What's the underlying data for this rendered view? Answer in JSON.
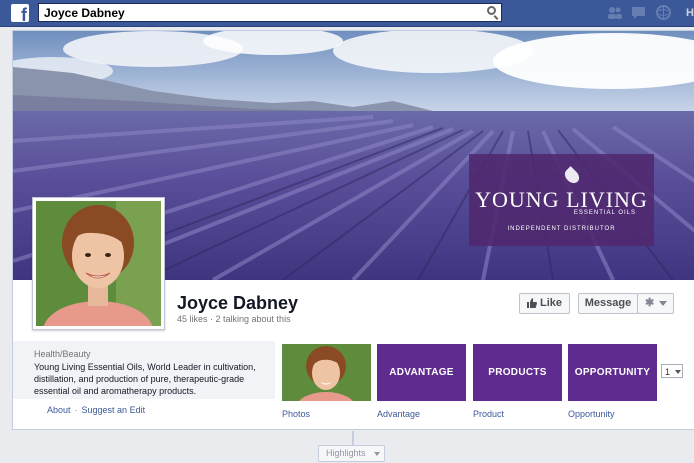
{
  "topbar": {
    "logo_glyph": "f",
    "search_value": "Joyce Dabney",
    "home_label": "H",
    "icons": [
      "friend-requests-icon",
      "messages-icon",
      "notifications-icon"
    ]
  },
  "cover": {
    "brand_name": "YOUNG LIVING",
    "brand_sub": "ESSENTIAL OILS",
    "brand_tagline": "INDEPENDENT DISTRIBUTOR",
    "brand_color": "#5f2b8e"
  },
  "page": {
    "name": "Joyce Dabney",
    "stats": "45 likes · 2 talking about this"
  },
  "actions": {
    "like_label": "Like",
    "message_label": "Message"
  },
  "about": {
    "category": "Health/Beauty",
    "description": "Young Living Essential Oils, World Leader in cultivation, distillation, and production of pure, therapeutic-grade essential oil and aromatherapy products.",
    "about_link": "About",
    "suggest_link": "Suggest an Edit"
  },
  "apps": {
    "photos_label": "Photos",
    "advantage_tile": "ADVANTAGE",
    "advantage_label": "Advantage",
    "products_tile": "PRODUCTS",
    "products_label": "Product",
    "opportunity_tile": "OPPORTUNITY",
    "opportunity_label": "Opportunity",
    "count": "1"
  },
  "timeline": {
    "highlights_label": "Highlights"
  }
}
